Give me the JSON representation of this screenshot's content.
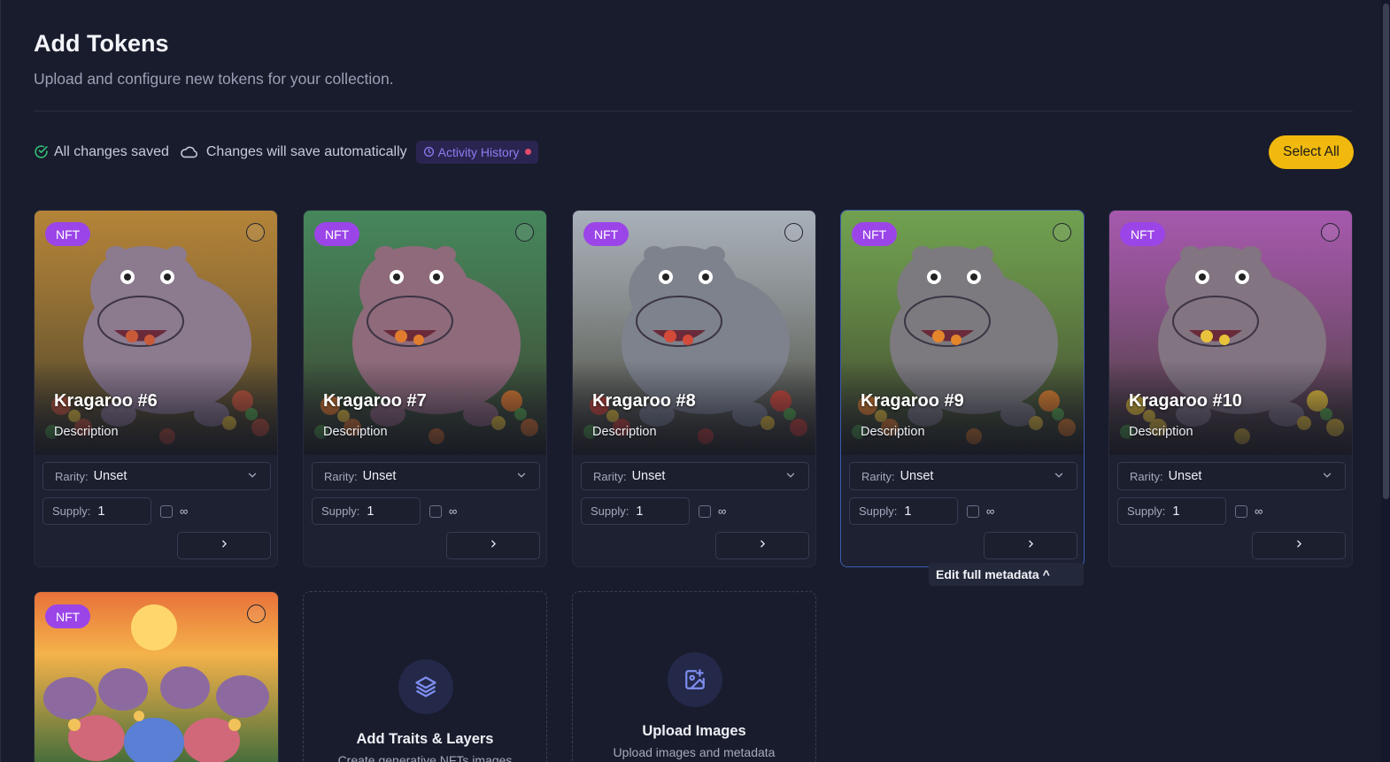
{
  "header": {
    "title": "Add Tokens",
    "subtitle": "Upload and configure new tokens for your collection."
  },
  "status": {
    "saved_label": "All changes saved",
    "auto_label": "Changes will save automatically",
    "activity_label": "Activity History",
    "saved_icon": "check-circle-icon",
    "auto_icon": "cloud-icon",
    "activity_icon": "clock-icon"
  },
  "toolbar": {
    "select_all_label": "Select All"
  },
  "cards": [
    {
      "badge": "NFT",
      "name": "Kragaroo #6",
      "description": "Description",
      "rarity_label": "Rarity:",
      "rarity_value": "Unset",
      "supply_label": "Supply:",
      "supply_value": "1",
      "infinite_label": "∞",
      "palette": [
        "#e6a43b",
        "#8c7a8f",
        "#c85a3a"
      ]
    },
    {
      "badge": "NFT",
      "name": "Kragaroo #7",
      "description": "Description",
      "rarity_label": "Rarity:",
      "rarity_value": "Unset",
      "supply_label": "Supply:",
      "supply_value": "1",
      "infinite_label": "∞",
      "palette": [
        "#54a86a",
        "#8e6a7a",
        "#e07c2e"
      ]
    },
    {
      "badge": "NFT",
      "name": "Kragaroo #8",
      "description": "Description",
      "rarity_label": "Rarity:",
      "rarity_value": "Unset",
      "supply_label": "Supply:",
      "supply_value": "1",
      "infinite_label": "∞",
      "palette": [
        "#d6dfe6",
        "#7d828c",
        "#d24b3a"
      ]
    },
    {
      "badge": "NFT",
      "name": "Kragaroo #9",
      "description": "Description",
      "rarity_label": "Rarity:",
      "rarity_value": "Unset",
      "supply_label": "Supply:",
      "supply_value": "1",
      "infinite_label": "∞",
      "palette": [
        "#8ccc5a",
        "#7c7a7e",
        "#e4852c"
      ]
    },
    {
      "badge": "NFT",
      "name": "Kragaroo #10",
      "description": "Description",
      "rarity_label": "Rarity:",
      "rarity_value": "Unset",
      "supply_label": "Supply:",
      "supply_value": "1",
      "infinite_label": "∞",
      "palette": [
        "#d46bd6",
        "#827480",
        "#e8c23a"
      ]
    }
  ],
  "tooltip": {
    "text": "Edit full metadata ^"
  },
  "second_row": {
    "group_card_badge": "NFT",
    "traits": {
      "title": "Add Traits & Layers",
      "subtitle": "Create generative NFTs images",
      "icon": "layers-icon"
    },
    "upload": {
      "title": "Upload Images",
      "subtitle": "Upload images and metadata",
      "icon": "image-plus-icon"
    }
  },
  "colors": {
    "accent": "#f1b90d",
    "badge": "#9b45e8",
    "activity": "#8d7cf2",
    "background": "#191c2c"
  }
}
